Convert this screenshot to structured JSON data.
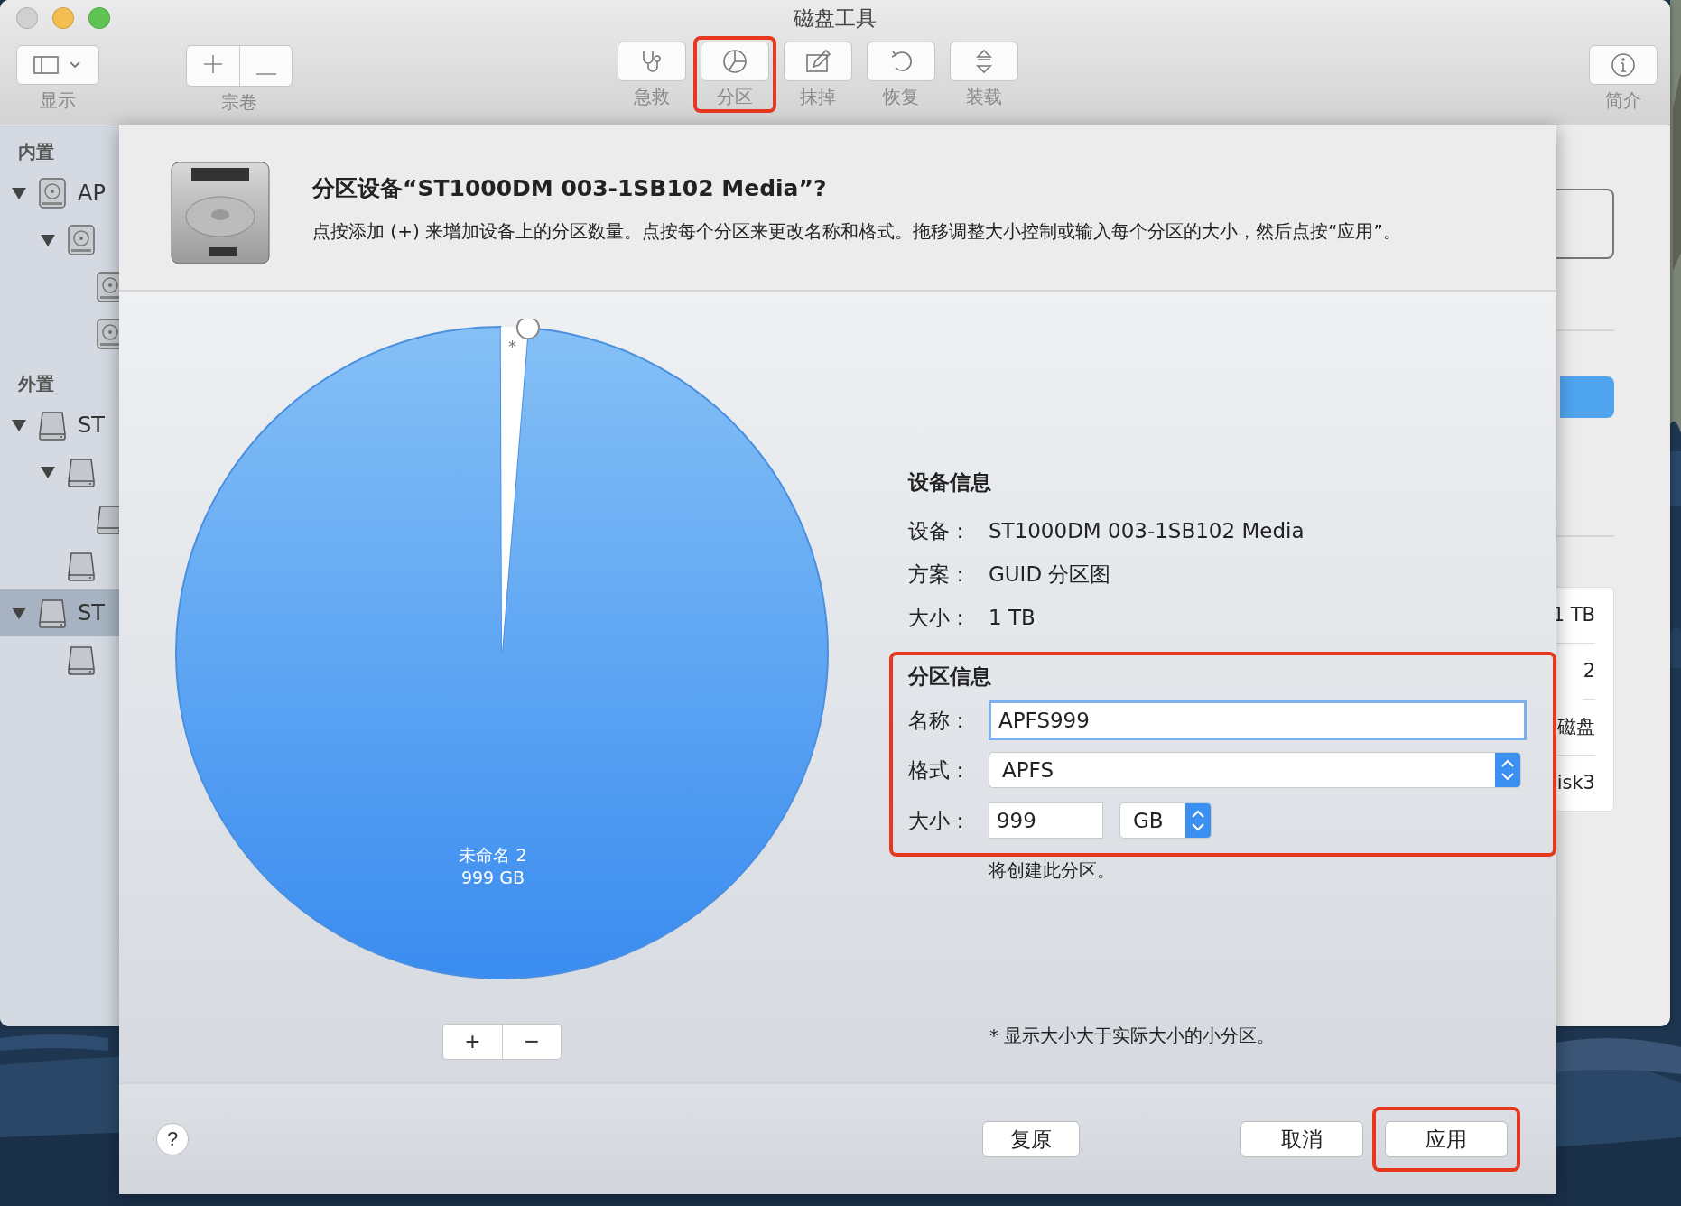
{
  "window": {
    "title": "磁盘工具"
  },
  "toolbar": {
    "left": [
      {
        "kind": "view",
        "label": "显示"
      },
      {
        "kind": "volume",
        "label": "宗卷"
      }
    ],
    "center": [
      {
        "kind": "firstaid",
        "label": "急救",
        "highlighted": false
      },
      {
        "kind": "partition",
        "label": "分区",
        "highlighted": true
      },
      {
        "kind": "erase",
        "label": "抹掉",
        "highlighted": false
      },
      {
        "kind": "restore",
        "label": "恢复",
        "highlighted": false
      },
      {
        "kind": "mount",
        "label": "装载",
        "highlighted": false
      }
    ],
    "right": [
      {
        "kind": "info",
        "label": "简介"
      }
    ]
  },
  "sidebar": {
    "sections": [
      {
        "title": "内置",
        "items": [
          {
            "kind": "internal",
            "label": "AP",
            "selected": false,
            "expanded": true,
            "children": [
              {
                "kind": "internal",
                "selected": false,
                "expanded": true,
                "children": [
                  {
                    "kind": "internal",
                    "selected": false
                  },
                  {
                    "kind": "internal",
                    "selected": false
                  }
                ]
              }
            ]
          }
        ]
      },
      {
        "title": "外置",
        "items": [
          {
            "kind": "external",
            "label": "ST",
            "selected": false,
            "expanded": true,
            "children": [
              {
                "kind": "external",
                "selected": false,
                "expanded": true,
                "children": [
                  {
                    "kind": "external",
                    "selected": false
                  }
                ]
              },
              {
                "kind": "external",
                "selected": false
              }
            ]
          },
          {
            "kind": "external",
            "label": "ST",
            "selected": true,
            "expanded": true,
            "children": [
              {
                "kind": "external",
                "selected": false
              }
            ]
          }
        ]
      }
    ]
  },
  "info_panel": {
    "values": [
      "1 TB",
      "2",
      "磁盘",
      "isk3"
    ]
  },
  "sheet": {
    "title": "分区设备“ST1000DM 003-1SB102 Media”?",
    "description": "点按添加 (+) 来增加设备上的分区数量。点按每个分区来更改名称和格式。拖移调整大小控制或输入每个分区的大小，然后点按“应用”。",
    "partitions": [
      {
        "label": "未命名 2",
        "size": "999 GB",
        "selected": true
      }
    ],
    "small_mark": "*",
    "add_button": "+",
    "remove_button": "−",
    "device_info": {
      "title": "设备信息",
      "rows": [
        {
          "label": "设备：",
          "value": "ST1000DM 003-1SB102 Media"
        },
        {
          "label": "方案：",
          "value": "GUID 分区图"
        },
        {
          "label": "大小：",
          "value": "1 TB"
        }
      ]
    },
    "partition_info": {
      "title": "分区信息",
      "highlighted": true,
      "name_label": "名称：",
      "name_value": "APFS999",
      "name_focused": true,
      "format_label": "格式：",
      "format_value": "APFS",
      "size_label": "大小：",
      "size_value": "999",
      "unit_value": "GB",
      "note": "将创建此分区。"
    },
    "footnote": "* 显示大小大于实际大小的小分区。",
    "help": "?",
    "buttons": [
      {
        "kind": "revert",
        "label": "复原",
        "highlighted": false
      },
      {
        "kind": "cancel",
        "label": "取消",
        "highlighted": false
      },
      {
        "kind": "apply",
        "label": "应用",
        "highlighted": true
      }
    ]
  }
}
